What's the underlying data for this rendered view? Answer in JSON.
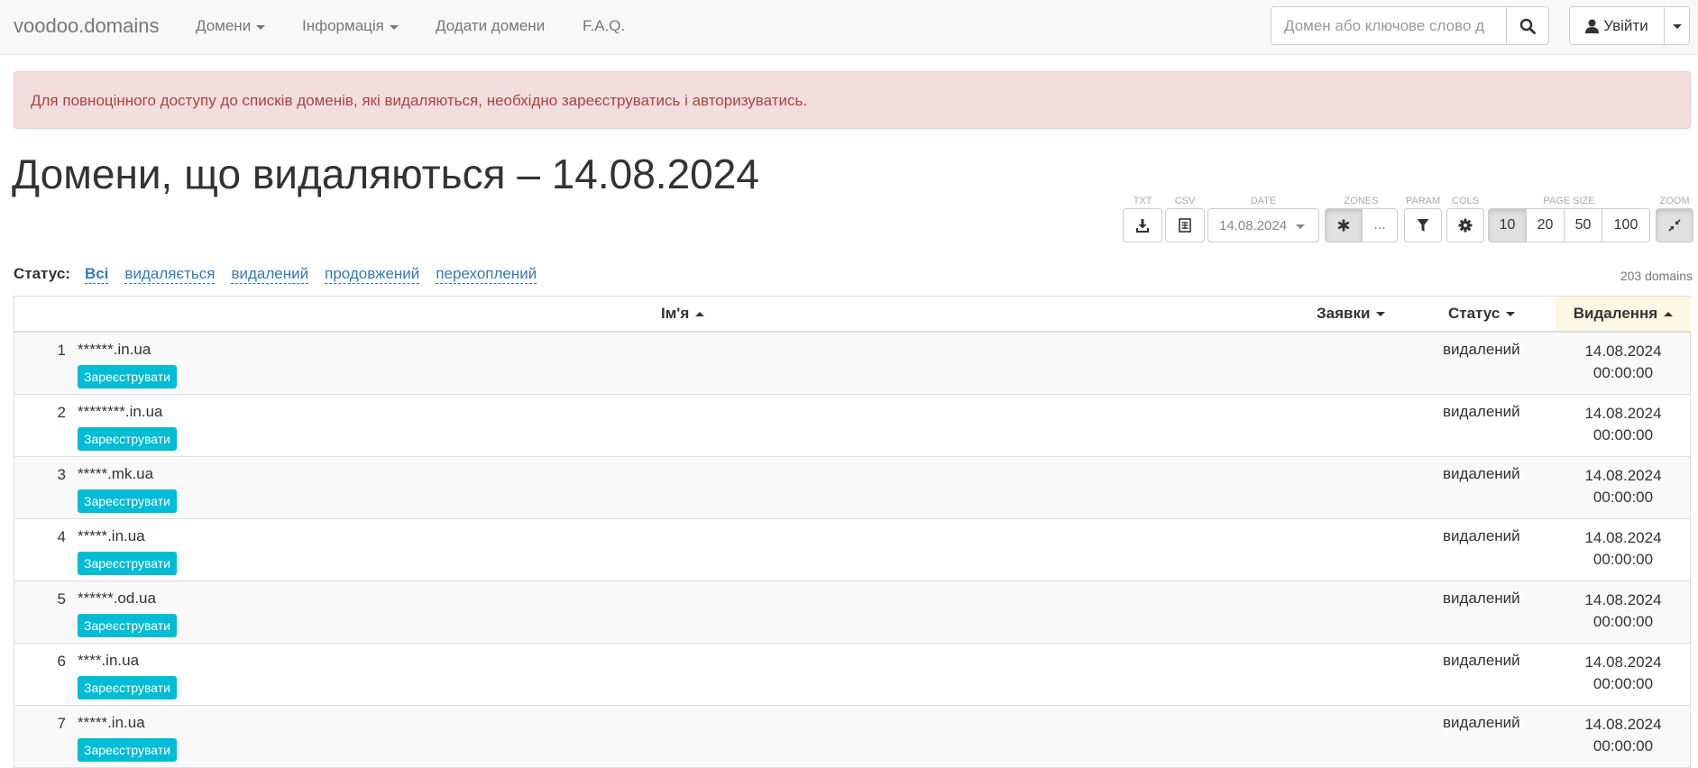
{
  "navbar": {
    "brand": "voodoo.domains",
    "items": [
      {
        "label": "Домени",
        "dropdown": true
      },
      {
        "label": "Інформація",
        "dropdown": true
      },
      {
        "label": "Додати домени",
        "dropdown": false
      },
      {
        "label": "F.A.Q.",
        "dropdown": false
      }
    ],
    "search_placeholder": "Домен або ключове слово д",
    "search_icon": "search-icon",
    "login_label": "Увійти",
    "login_icon": "user-icon"
  },
  "alert": {
    "text": "Для повноцінного доступу до списків доменів, які видаляються, необхідно зареєструватись і авторизуватись.",
    "bg_color": "#f2dede",
    "text_color": "#a94442"
  },
  "page_title": "Домени, що видаляються – 14.08.2024",
  "toolbar": {
    "txt_label": "TXT",
    "csv_label": "CSV",
    "date_label": "DATE",
    "date_value": "14.08.2024",
    "zones_label": "ZONES",
    "zones_more": "...",
    "param_label": "PARAM",
    "cols_label": "COLS",
    "page_size_label": "PAGE SIZE",
    "page_sizes": [
      "10",
      "20",
      "50",
      "100"
    ],
    "page_size_selected": "10",
    "zoom_label": "ZOOM"
  },
  "filters": {
    "label": "Статус:",
    "items": [
      "Всі",
      "видаляється",
      "видалений",
      "продовжений",
      "перехоплений"
    ],
    "active": "Всі",
    "count": "203 domains"
  },
  "table": {
    "headers": {
      "name": "Ім'я",
      "bids": "Заявки",
      "status": "Статус",
      "removal": "Видалення"
    },
    "sorted_column_color": "#fcf8e3",
    "register_label": "Зареєструвати",
    "register_color": "#00bcd4",
    "rows": [
      {
        "n": "1",
        "name": "******.in.ua",
        "status": "видалений",
        "date": "14.08.2024",
        "time": "00:00:00"
      },
      {
        "n": "2",
        "name": "********.in.ua",
        "status": "видалений",
        "date": "14.08.2024",
        "time": "00:00:00"
      },
      {
        "n": "3",
        "name": "*****.mk.ua",
        "status": "видалений",
        "date": "14.08.2024",
        "time": "00:00:00"
      },
      {
        "n": "4",
        "name": "*****.in.ua",
        "status": "видалений",
        "date": "14.08.2024",
        "time": "00:00:00"
      },
      {
        "n": "5",
        "name": "******.od.ua",
        "status": "видалений",
        "date": "14.08.2024",
        "time": "00:00:00"
      },
      {
        "n": "6",
        "name": "****.in.ua",
        "status": "видалений",
        "date": "14.08.2024",
        "time": "00:00:00"
      },
      {
        "n": "7",
        "name": "*****.in.ua",
        "status": "видалений",
        "date": "14.08.2024",
        "time": "00:00:00"
      }
    ]
  }
}
